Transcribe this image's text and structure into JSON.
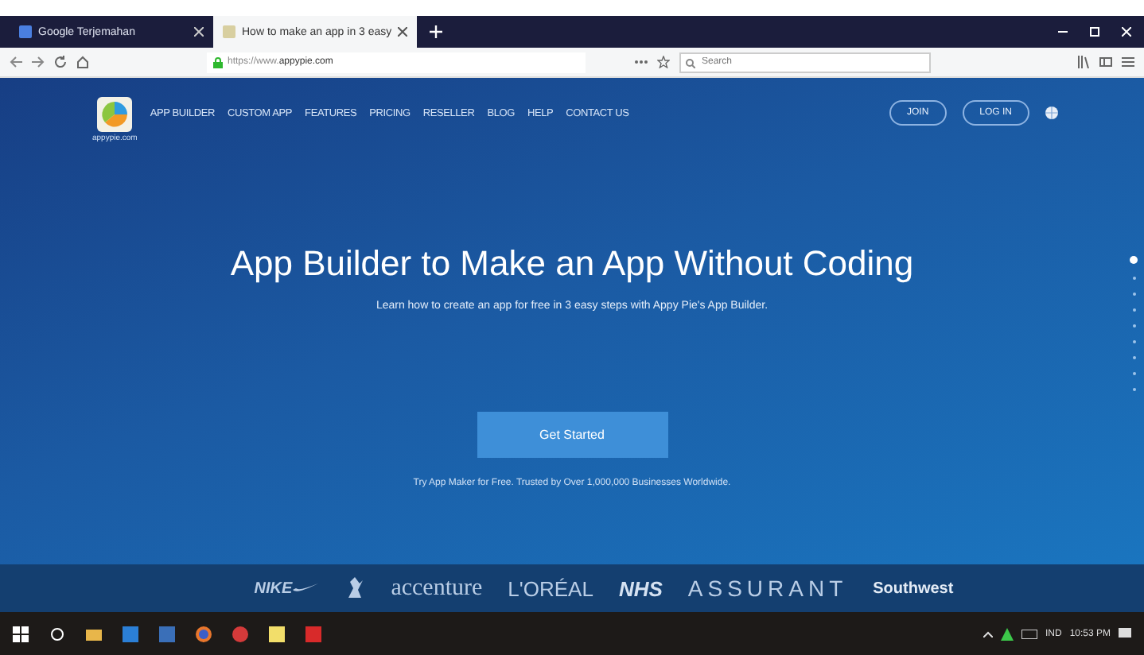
{
  "browser": {
    "tabs": [
      {
        "label": "Google Terjemahan",
        "selected": false
      },
      {
        "label": "How to make an app in 3 easy",
        "selected": true
      }
    ],
    "url_prefix": "https://www.",
    "url_domain": "appypie.com",
    "search": {
      "placeholder": "Search"
    }
  },
  "site": {
    "logo_caption": "appypie.com",
    "nav": [
      "APP BUILDER",
      "CUSTOM APP",
      "FEATURES",
      "PRICING",
      "RESELLER",
      "BLOG",
      "HELP",
      "CONTACT US"
    ],
    "buttons": [
      "JOIN",
      "LOG IN"
    ]
  },
  "hero": {
    "title": "App Builder to Make an App Without Coding",
    "subtitle": "Learn how to create an app for free in 3 easy steps with Appy Pie's App Builder.",
    "cta": "Get Started",
    "note": "Try App Maker for Free. Trusted by Over 1,000,000 Businesses Worldwide."
  },
  "slides": [
    {
      "selected": true
    },
    {
      "selected": false
    },
    {
      "selected": false
    },
    {
      "selected": false
    },
    {
      "selected": false
    },
    {
      "selected": false
    },
    {
      "selected": false
    },
    {
      "selected": false
    },
    {
      "selected": false
    }
  ],
  "clients": [
    {
      "kind": "swoosh",
      "label": "NIKE"
    },
    {
      "kind": "icon"
    },
    {
      "kind": "text",
      "label": "accenture"
    },
    {
      "kind": "text",
      "label": "L'ORÉAL"
    },
    {
      "kind": "text",
      "label": "NHS"
    },
    {
      "kind": "text",
      "label": "ASSURANT"
    },
    {
      "kind": "text",
      "label": "Southwest"
    }
  ],
  "taskbar": {
    "language": "IND",
    "time": "10:53 PM"
  }
}
